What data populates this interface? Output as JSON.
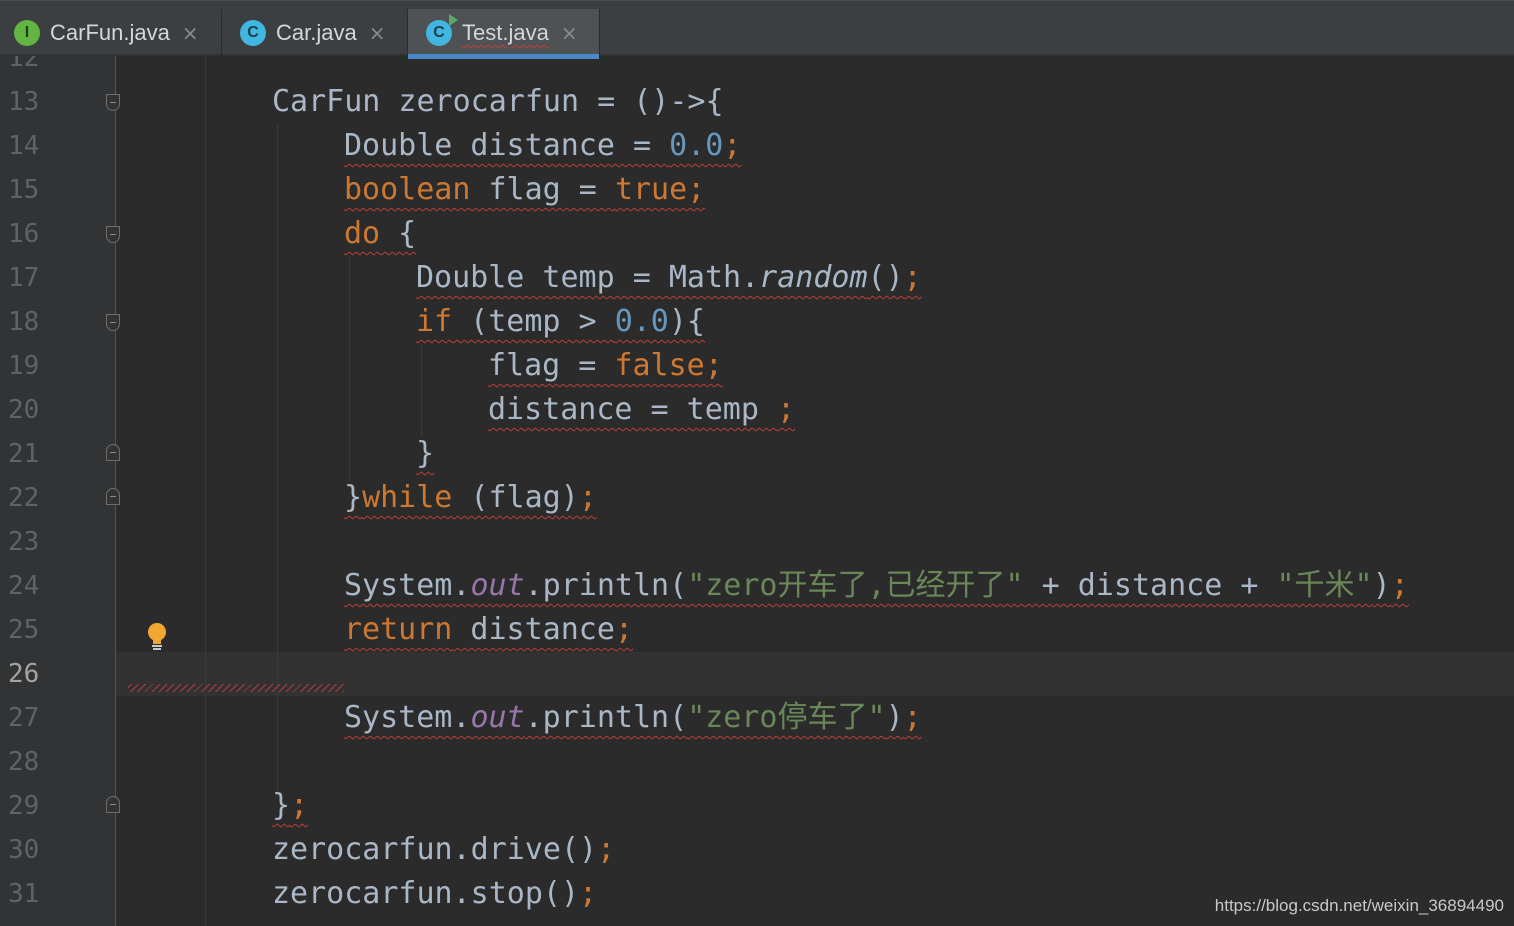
{
  "tabs": [
    {
      "label": "CarFun.java",
      "icon": "interface-file-icon",
      "icon_letter": "I",
      "active": false
    },
    {
      "label": "Car.java",
      "icon": "class-file-icon",
      "icon_letter": "C",
      "active": false
    },
    {
      "label": "Test.java",
      "icon": "runnable-class-file-icon",
      "icon_letter": "C",
      "active": true
    }
  ],
  "tab_close_glyph": "×",
  "current_line": 26,
  "partial_top_line": "12",
  "lines": [
    {
      "num": "13",
      "parts": [
        [
          "p",
          "CarFun zerocarfun = ()->{"
        ]
      ]
    },
    {
      "num": "14",
      "parts": [
        [
          "p",
          "Double distance = "
        ],
        [
          "n",
          "0.0"
        ],
        [
          "k",
          ";"
        ]
      ]
    },
    {
      "num": "15",
      "parts": [
        [
          "k",
          "boolean"
        ],
        [
          "p",
          " flag = "
        ],
        [
          "k",
          "true;"
        ]
      ]
    },
    {
      "num": "16",
      "parts": [
        [
          "k",
          "do"
        ],
        [
          "p",
          " {"
        ]
      ]
    },
    {
      "num": "17",
      "parts": [
        [
          "p",
          "Double temp = Math."
        ],
        [
          "i",
          "random"
        ],
        [
          "p",
          "()"
        ],
        [
          "k",
          ";"
        ]
      ]
    },
    {
      "num": "18",
      "parts": [
        [
          "k",
          "if"
        ],
        [
          "p",
          " (temp > "
        ],
        [
          "n",
          "0.0"
        ],
        [
          "p",
          "){"
        ]
      ]
    },
    {
      "num": "19",
      "parts": [
        [
          "p",
          "flag = "
        ],
        [
          "k",
          "false;"
        ]
      ]
    },
    {
      "num": "20",
      "parts": [
        [
          "p",
          "distance = temp "
        ],
        [
          "k",
          ";"
        ]
      ]
    },
    {
      "num": "21",
      "parts": [
        [
          "p",
          "}"
        ]
      ]
    },
    {
      "num": "22",
      "parts": [
        [
          "p",
          "}"
        ],
        [
          "k",
          "while"
        ],
        [
          "p",
          " (flag)"
        ],
        [
          "k",
          ";"
        ]
      ]
    },
    {
      "num": "23",
      "parts": []
    },
    {
      "num": "24",
      "parts": [
        [
          "p",
          "System."
        ],
        [
          "f",
          "out"
        ],
        [
          "p",
          ".println("
        ],
        [
          "s",
          "\"zero开车了,已经开了\""
        ],
        [
          "p",
          " + distance + "
        ],
        [
          "s",
          "\"千米\""
        ],
        [
          "p",
          ")"
        ],
        [
          "k",
          ";"
        ]
      ]
    },
    {
      "num": "25",
      "parts": [
        [
          "k",
          "return"
        ],
        [
          "p",
          " distance"
        ],
        [
          "k",
          ";"
        ]
      ]
    },
    {
      "num": "26",
      "parts": []
    },
    {
      "num": "27",
      "parts": [
        [
          "p",
          "System."
        ],
        [
          "f",
          "out"
        ],
        [
          "p",
          ".println("
        ],
        [
          "s",
          "\"zero停车了\""
        ],
        [
          "p",
          ")"
        ],
        [
          "k",
          ";"
        ]
      ]
    },
    {
      "num": "28",
      "parts": []
    },
    {
      "num": "29",
      "parts": [
        [
          "p",
          "}"
        ],
        [
          "k",
          ";"
        ]
      ]
    },
    {
      "num": "30",
      "parts": [
        [
          "p",
          "zerocarfun.drive()"
        ],
        [
          "k",
          ";"
        ]
      ]
    },
    {
      "num": "31",
      "parts": [
        [
          "p",
          "zerocarfun.stop()"
        ],
        [
          "k",
          ";"
        ]
      ]
    }
  ],
  "watermark": "https://blog.csdn.net/weixin_36894490",
  "colors": {
    "background": "#2b2b2b",
    "keyword": "#cc7832",
    "number": "#6897bb",
    "string": "#6a8759",
    "field": "#9876aa",
    "plain": "#a9b7c6",
    "error_underline": "#bc3f3c"
  }
}
